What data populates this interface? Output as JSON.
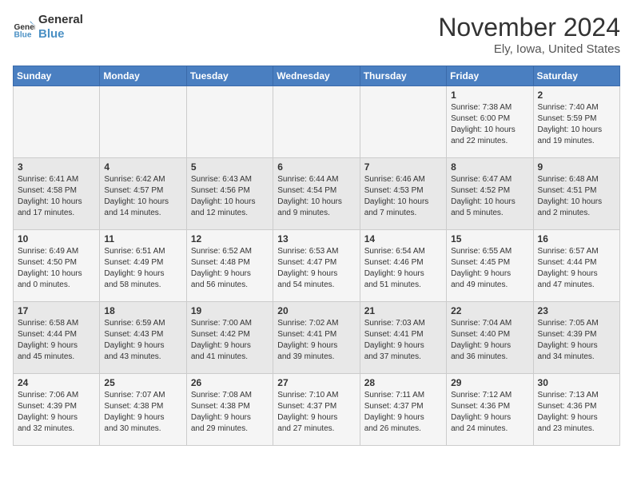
{
  "logo": {
    "line1": "General",
    "line2": "Blue"
  },
  "title": "November 2024",
  "location": "Ely, Iowa, United States",
  "weekdays": [
    "Sunday",
    "Monday",
    "Tuesday",
    "Wednesday",
    "Thursday",
    "Friday",
    "Saturday"
  ],
  "weeks": [
    [
      {
        "day": "",
        "info": ""
      },
      {
        "day": "",
        "info": ""
      },
      {
        "day": "",
        "info": ""
      },
      {
        "day": "",
        "info": ""
      },
      {
        "day": "",
        "info": ""
      },
      {
        "day": "1",
        "info": "Sunrise: 7:38 AM\nSunset: 6:00 PM\nDaylight: 10 hours\nand 22 minutes."
      },
      {
        "day": "2",
        "info": "Sunrise: 7:40 AM\nSunset: 5:59 PM\nDaylight: 10 hours\nand 19 minutes."
      }
    ],
    [
      {
        "day": "3",
        "info": "Sunrise: 6:41 AM\nSunset: 4:58 PM\nDaylight: 10 hours\nand 17 minutes."
      },
      {
        "day": "4",
        "info": "Sunrise: 6:42 AM\nSunset: 4:57 PM\nDaylight: 10 hours\nand 14 minutes."
      },
      {
        "day": "5",
        "info": "Sunrise: 6:43 AM\nSunset: 4:56 PM\nDaylight: 10 hours\nand 12 minutes."
      },
      {
        "day": "6",
        "info": "Sunrise: 6:44 AM\nSunset: 4:54 PM\nDaylight: 10 hours\nand 9 minutes."
      },
      {
        "day": "7",
        "info": "Sunrise: 6:46 AM\nSunset: 4:53 PM\nDaylight: 10 hours\nand 7 minutes."
      },
      {
        "day": "8",
        "info": "Sunrise: 6:47 AM\nSunset: 4:52 PM\nDaylight: 10 hours\nand 5 minutes."
      },
      {
        "day": "9",
        "info": "Sunrise: 6:48 AM\nSunset: 4:51 PM\nDaylight: 10 hours\nand 2 minutes."
      }
    ],
    [
      {
        "day": "10",
        "info": "Sunrise: 6:49 AM\nSunset: 4:50 PM\nDaylight: 10 hours\nand 0 minutes."
      },
      {
        "day": "11",
        "info": "Sunrise: 6:51 AM\nSunset: 4:49 PM\nDaylight: 9 hours\nand 58 minutes."
      },
      {
        "day": "12",
        "info": "Sunrise: 6:52 AM\nSunset: 4:48 PM\nDaylight: 9 hours\nand 56 minutes."
      },
      {
        "day": "13",
        "info": "Sunrise: 6:53 AM\nSunset: 4:47 PM\nDaylight: 9 hours\nand 54 minutes."
      },
      {
        "day": "14",
        "info": "Sunrise: 6:54 AM\nSunset: 4:46 PM\nDaylight: 9 hours\nand 51 minutes."
      },
      {
        "day": "15",
        "info": "Sunrise: 6:55 AM\nSunset: 4:45 PM\nDaylight: 9 hours\nand 49 minutes."
      },
      {
        "day": "16",
        "info": "Sunrise: 6:57 AM\nSunset: 4:44 PM\nDaylight: 9 hours\nand 47 minutes."
      }
    ],
    [
      {
        "day": "17",
        "info": "Sunrise: 6:58 AM\nSunset: 4:44 PM\nDaylight: 9 hours\nand 45 minutes."
      },
      {
        "day": "18",
        "info": "Sunrise: 6:59 AM\nSunset: 4:43 PM\nDaylight: 9 hours\nand 43 minutes."
      },
      {
        "day": "19",
        "info": "Sunrise: 7:00 AM\nSunset: 4:42 PM\nDaylight: 9 hours\nand 41 minutes."
      },
      {
        "day": "20",
        "info": "Sunrise: 7:02 AM\nSunset: 4:41 PM\nDaylight: 9 hours\nand 39 minutes."
      },
      {
        "day": "21",
        "info": "Sunrise: 7:03 AM\nSunset: 4:41 PM\nDaylight: 9 hours\nand 37 minutes."
      },
      {
        "day": "22",
        "info": "Sunrise: 7:04 AM\nSunset: 4:40 PM\nDaylight: 9 hours\nand 36 minutes."
      },
      {
        "day": "23",
        "info": "Sunrise: 7:05 AM\nSunset: 4:39 PM\nDaylight: 9 hours\nand 34 minutes."
      }
    ],
    [
      {
        "day": "24",
        "info": "Sunrise: 7:06 AM\nSunset: 4:39 PM\nDaylight: 9 hours\nand 32 minutes."
      },
      {
        "day": "25",
        "info": "Sunrise: 7:07 AM\nSunset: 4:38 PM\nDaylight: 9 hours\nand 30 minutes."
      },
      {
        "day": "26",
        "info": "Sunrise: 7:08 AM\nSunset: 4:38 PM\nDaylight: 9 hours\nand 29 minutes."
      },
      {
        "day": "27",
        "info": "Sunrise: 7:10 AM\nSunset: 4:37 PM\nDaylight: 9 hours\nand 27 minutes."
      },
      {
        "day": "28",
        "info": "Sunrise: 7:11 AM\nSunset: 4:37 PM\nDaylight: 9 hours\nand 26 minutes."
      },
      {
        "day": "29",
        "info": "Sunrise: 7:12 AM\nSunset: 4:36 PM\nDaylight: 9 hours\nand 24 minutes."
      },
      {
        "day": "30",
        "info": "Sunrise: 7:13 AM\nSunset: 4:36 PM\nDaylight: 9 hours\nand 23 minutes."
      }
    ]
  ]
}
